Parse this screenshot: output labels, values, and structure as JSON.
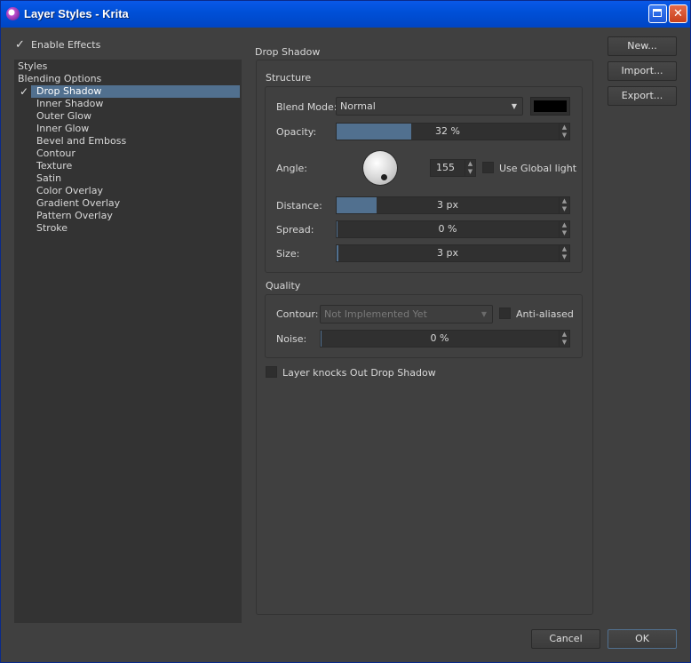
{
  "window": {
    "title": "Layer Styles - Krita"
  },
  "enable_effects": {
    "label": "Enable Effects",
    "checked": true
  },
  "styles_list": {
    "items": [
      "Styles",
      "Blending Options",
      "Drop Shadow",
      "Inner Shadow",
      "Outer Glow",
      "Inner Glow",
      "Bevel and Emboss",
      "Contour",
      "Texture",
      "Satin",
      "Color Overlay",
      "Gradient Overlay",
      "Pattern Overlay",
      "Stroke"
    ],
    "selected": "Drop Shadow"
  },
  "panel": {
    "title": "Drop Shadow"
  },
  "structure": {
    "title": "Structure",
    "blend_mode_label": "Blend Mode:",
    "blend_mode_value": "Normal",
    "shadow_color": "#000000",
    "opacity_label": "Opacity:",
    "opacity_value": "32 %",
    "opacity_fraction": 0.32,
    "angle_label": "Angle:",
    "angle_value": "155",
    "use_global_light_label": "Use Global light",
    "distance_label": "Distance:",
    "distance_value": "3 px",
    "spread_label": "Spread:",
    "spread_value": "0 %",
    "size_label": "Size:",
    "size_value": "3 px"
  },
  "quality": {
    "title": "Quality",
    "contour_label": "Contour:",
    "contour_value": "Not Implemented Yet",
    "anti_aliased_label": "Anti-aliased",
    "noise_label": "Noise:",
    "noise_value": "0 %"
  },
  "knockout": {
    "label": "Layer knocks Out Drop Shadow"
  },
  "side_buttons": {
    "new": "New...",
    "import": "Import...",
    "export": "Export..."
  },
  "footer": {
    "cancel": "Cancel",
    "ok": "OK"
  },
  "colors": {
    "accent": "#51708f",
    "titlebar": "#0054e3",
    "background": "#404040"
  }
}
